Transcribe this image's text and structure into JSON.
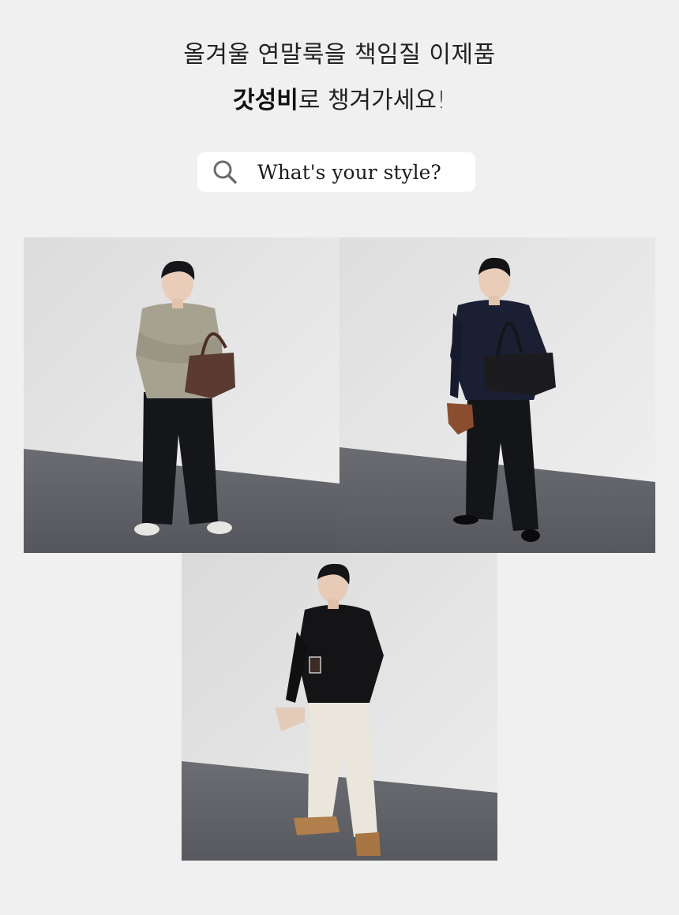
{
  "headline": {
    "line1": "올겨울 연말룩을 책임질 이제품",
    "line2_bold": "갓성비",
    "line2_rest": "로 챙겨가세요!"
  },
  "search": {
    "icon": "search-icon",
    "text": "What's your style?"
  },
  "photos": [
    {
      "outfit": "beige cable-knit sweater, black cargo pants, brown suede tote"
    },
    {
      "outfit": "navy cable-knit sweater, black wide pants, black leather bag"
    },
    {
      "outfit": "black cable-knit sweater, cream wide pants, tan boots"
    }
  ],
  "colors": {
    "background": "#f0f0f0",
    "search_bg": "#ffffff",
    "wall": "#e4e4e4",
    "floor": "#5b5d63"
  }
}
